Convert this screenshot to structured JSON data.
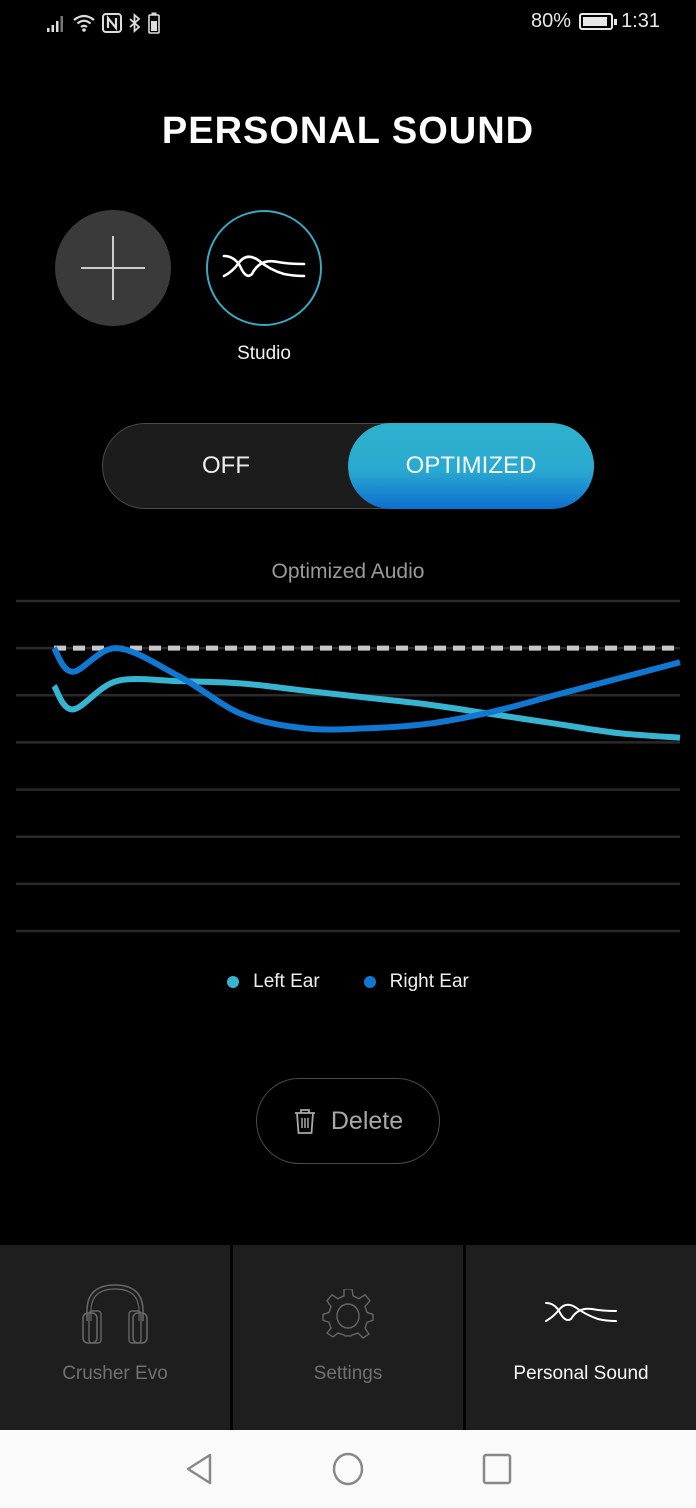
{
  "status_bar": {
    "battery_percent": "80%",
    "battery_level": 0.8,
    "time": "1:31",
    "icons": [
      "signal-icon",
      "wifi-icon",
      "nfc-icon",
      "bluetooth-icon",
      "headset-battery-icon"
    ]
  },
  "header": {
    "title": "PERSONAL SOUND"
  },
  "profiles": {
    "add_icon": "plus-icon",
    "items": [
      {
        "label": "Studio",
        "icon": "sound-wave-icon",
        "selected": true
      }
    ]
  },
  "mode_toggle": {
    "options": [
      "OFF",
      "OPTIMIZED"
    ],
    "selected": "OPTIMIZED"
  },
  "chart_data": {
    "type": "line",
    "title": "Optimized Audio",
    "xlabel": "",
    "ylabel": "",
    "grid": true,
    "x": [
      0,
      0.03,
      0.1,
      0.2,
      0.3,
      0.4,
      0.5,
      0.6,
      0.7,
      0.8,
      0.9,
      1.0
    ],
    "ylim": [
      0,
      7
    ],
    "reference_line": {
      "name": "Baseline",
      "value": 6,
      "style": "dashed"
    },
    "series": [
      {
        "name": "Left Ear",
        "color": "#36b4d0",
        "values": [
          5.2,
          4.7,
          5.3,
          5.3,
          5.25,
          5.1,
          4.95,
          4.8,
          4.6,
          4.4,
          4.2,
          4.1
        ]
      },
      {
        "name": "Right Ear",
        "color": "#1078d0",
        "values": [
          6.0,
          5.5,
          6.0,
          5.4,
          4.6,
          4.3,
          4.3,
          4.4,
          4.65,
          5.0,
          5.35,
          5.7
        ]
      }
    ],
    "legend": "bottom-center"
  },
  "legend": {
    "items": [
      {
        "label": "Left Ear",
        "color": "#36b4d0"
      },
      {
        "label": "Right Ear",
        "color": "#1078d0"
      }
    ]
  },
  "actions": {
    "delete_label": "Delete"
  },
  "tab_bar": {
    "tabs": [
      {
        "label": "Crusher Evo",
        "icon": "headphones-icon",
        "active": false
      },
      {
        "label": "Settings",
        "icon": "gear-icon",
        "active": false
      },
      {
        "label": "Personal Sound",
        "icon": "sound-wave-icon",
        "active": true
      }
    ]
  },
  "nav_bar": {
    "buttons": [
      "back",
      "home",
      "recents"
    ]
  }
}
